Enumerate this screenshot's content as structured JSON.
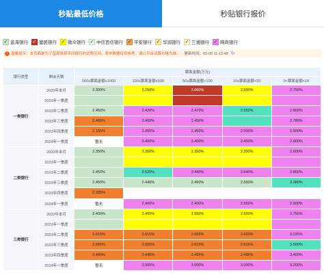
{
  "tabs": [
    {
      "label": "秒贴最低价格",
      "active": true
    },
    {
      "label": "秒贴银行报价",
      "active": false
    }
  ],
  "legend": [
    {
      "label": "蓝海银行",
      "color": "#c8e6c9",
      "check": "✓"
    },
    {
      "label": "富民银行",
      "color": "#c0392b",
      "check": "✓"
    },
    {
      "label": "微众银行",
      "color": "#ffff00",
      "check": "✓"
    },
    {
      "label": "中信百信银行",
      "color": "#e8f5e9",
      "check": "✓"
    },
    {
      "label": "平安银行",
      "color": "#f5a04a",
      "check": "✓"
    },
    {
      "label": "华润银行",
      "color": "#ffe9a0",
      "check": "✓"
    },
    {
      "label": "三湘银行",
      "color": "#fff3c4",
      "check": "✓"
    },
    {
      "label": "网商银行",
      "color": "#ee82ee",
      "check": "✓"
    }
  ],
  "notice": {
    "text": "温馨提示：本页面是为了直观体现不同银行的优势区间，表中数据仅供参考，请以平台试算价格为准。",
    "timestamp": "更新时间：02-08 11:13:48",
    "refresh_icon": "↻"
  },
  "table": {
    "header_type": "银行类型",
    "header_period": "剩余天数",
    "header_amount": "票面金额(万元)",
    "amount_columns": [
      "500≤票面金额≤1000",
      "100≤票面金额≤500",
      "50≤票面金额<100",
      "10≤票面金额<50",
      "0<票面金额<10"
    ],
    "groups": [
      {
        "type": "一类银行",
        "rows": [
          {
            "period": "2023年本月",
            "cells": [
              {
                "value": "2.300%",
                "color": "#c8e6c9"
              },
              {
                "value": "2.250%",
                "color": "#ffff00"
              },
              {
                "value": "2.060%",
                "color": "#c0392b",
                "dark": true
              },
              {
                "value": "2.550%",
                "color": "#ffff00"
              },
              {
                "value": "2.750%",
                "color": "#ee82ee"
              }
            ]
          },
          {
            "period": "2023年一季度",
            "cells": [
              {
                "value": "",
                "color": "#c8e6c9"
              },
              {
                "value": "",
                "color": "#ffff00"
              },
              {
                "value": "",
                "color": "#c0392b"
              },
              {
                "value": "",
                "color": "#ffff00"
              },
              {
                "value": "",
                "color": "#ee82ee"
              }
            ]
          },
          {
            "period": "2023年二季度",
            "cells": [
              {
                "value": "2.450%",
                "color": "#c8e6c9"
              },
              {
                "value": "2.420%",
                "color": "#ee82ee"
              },
              {
                "value": "2.470%",
                "color": "#ee82ee"
              },
              {
                "value": "2.550%",
                "color": "#55e0c0"
              },
              {
                "value": "2.860%",
                "color": "#ee82ee"
              }
            ]
          },
          {
            "period": "2023年三季度",
            "cells": [
              {
                "value": "2.485%",
                "color": "#f08030"
              },
              {
                "value": "2.400%",
                "color": "#ee82ee"
              },
              {
                "value": "2.450%",
                "color": "#ee82ee"
              },
              {
                "value": "",
                "color": "#55e0c0"
              },
              {
                "value": "2.780%",
                "color": "#ee82ee"
              }
            ]
          },
          {
            "period": "2023年四季度",
            "cells": [
              {
                "value": "2.155%",
                "color": "#f08030"
              },
              {
                "value": "2.450%",
                "color": "#ee82ee"
              },
              {
                "value": "2.450%",
                "color": "#ee82ee"
              },
              {
                "value": "2.500%",
                "color": "#ee82ee"
              },
              {
                "value": "2.900%",
                "color": "#ee82ee"
              }
            ]
          },
          {
            "period": "2024年一季度",
            "cells": [
              {
                "value": "暂无",
                "color": "#ffffff"
              },
              {
                "value": "2.400%",
                "color": "#ee82ee"
              },
              {
                "value": "2.400%",
                "color": "#ee82ee"
              },
              {
                "value": "2.450%",
                "color": "#ee82ee"
              },
              {
                "value": "2.900%",
                "color": "#ee82ee"
              }
            ]
          }
        ]
      },
      {
        "type": "二类银行",
        "rows": [
          {
            "period": "2023年本月",
            "cells": [
              {
                "value": "2.350%",
                "color": "#c8e6c9"
              },
              {
                "value": "2.350%",
                "color": "#ffff00"
              },
              {
                "value": "2.350%",
                "color": "#ffff00"
              },
              {
                "value": "2.350%",
                "color": "#ffff00"
              },
              {
                "value": "2.600%",
                "color": "#ee82ee"
              }
            ]
          },
          {
            "period": "2023年一季度",
            "cells": [
              {
                "value": "",
                "color": "#c8e6c9"
              },
              {
                "value": "",
                "color": "#ffff00"
              },
              {
                "value": "",
                "color": "#ffff00"
              },
              {
                "value": "",
                "color": "#ffff00"
              },
              {
                "value": "",
                "color": "#ee82ee"
              }
            ]
          },
          {
            "period": "2023年二季度",
            "cells": [
              {
                "value": "2.450%",
                "color": "#c8e6c9"
              },
              {
                "value": "2.520%",
                "color": "#55e0c0"
              },
              {
                "value": "2.440%",
                "color": "#ee82ee"
              },
              {
                "value": "2.540%",
                "color": "#ee82ee"
              },
              {
                "value": "2.800%",
                "color": "#ee82ee"
              }
            ]
          },
          {
            "period": "2023年三季度",
            "cells": [
              {
                "value": "2.450%",
                "color": "#c8e6c9"
              },
              {
                "value": "2.440%",
                "color": "#c8e6c9"
              },
              {
                "value": "2.450%",
                "color": "#c8e6c9"
              },
              {
                "value": "2.550%",
                "color": "#c8e6c9"
              },
              {
                "value": "3.380%",
                "color": "#55e0c0"
              }
            ]
          },
          {
            "period": "2023年四季度",
            "cells": [
              {
                "value": "2.285%",
                "color": "#f08030"
              },
              {
                "value": "",
                "color": "#ffffff"
              },
              {
                "value": "",
                "color": "#ffffff"
              },
              {
                "value": "",
                "color": "#ffffff"
              },
              {
                "value": "",
                "color": "#ffffff"
              }
            ]
          },
          {
            "period": "2024年一季度",
            "cells": [
              {
                "value": "暂无",
                "color": "#ffffff"
              },
              {
                "value": "2.400%",
                "color": "#ee82ee"
              },
              {
                "value": "2.400%",
                "color": "#ee82ee"
              },
              {
                "value": "2.550%",
                "color": "#ee82ee"
              },
              {
                "value": "2.900%",
                "color": "#ee82ee"
              }
            ]
          }
        ]
      },
      {
        "type": "三类银行",
        "rows": [
          {
            "period": "2023年本月",
            "cells": [
              {
                "value": "2.400%",
                "color": "#c8e6c9"
              },
              {
                "value": "2.400%",
                "color": "#ffff00"
              },
              {
                "value": "2.550%",
                "color": "#ffff00"
              },
              {
                "value": "2.650%",
                "color": "#ffff00"
              },
              {
                "value": "2.750%",
                "color": "#ee82ee"
              }
            ]
          },
          {
            "period": "2023年一季度",
            "cells": [
              {
                "value": "",
                "color": "#c8e6c9"
              },
              {
                "value": "",
                "color": "#ffff00"
              },
              {
                "value": "",
                "color": "#ffff00"
              },
              {
                "value": "",
                "color": "#ffff00"
              },
              {
                "value": "",
                "color": "#ee82ee"
              }
            ]
          },
          {
            "period": "2023年二季度",
            "cells": [
              {
                "value": "2.615%",
                "color": "#f08030"
              },
              {
                "value": "2.615%",
                "color": "#f08030"
              },
              {
                "value": "2.665%",
                "color": "#f08030"
              },
              {
                "value": "2.665%",
                "color": "#f08030"
              },
              {
                "value": "3.225%",
                "color": "#ee82ee"
              }
            ]
          },
          {
            "period": "2023年三季度",
            "cells": [
              {
                "value": "2.565%",
                "color": "#f08030"
              },
              {
                "value": "2.565%",
                "color": "#f08030"
              },
              {
                "value": "2.615%",
                "color": "#f08030"
              },
              {
                "value": "2.615%",
                "color": "#f08030"
              },
              {
                "value": "3.500%",
                "color": "#55e0c0"
              }
            ]
          },
          {
            "period": "2023年四季度",
            "cells": [
              {
                "value": "2.445%",
                "color": "#f08030"
              },
              {
                "value": "2.445%",
                "color": "#f08030"
              },
              {
                "value": "2.495%",
                "color": "#f08030"
              },
              {
                "value": "2.495%",
                "color": "#f08030"
              },
              {
                "value": "3.400%",
                "color": "#ee82ee"
              }
            ]
          },
          {
            "period": "2024年一季度",
            "cells": [
              {
                "value": "暂无",
                "color": "#ffffff"
              },
              {
                "value": "2.900%",
                "color": "#ee82ee"
              },
              {
                "value": "3.000%",
                "color": "#ee82ee"
              },
              {
                "value": "3.000%",
                "color": "#ee82ee"
              },
              {
                "value": "3.200%",
                "color": "#ee82ee"
              }
            ]
          }
        ]
      }
    ]
  }
}
